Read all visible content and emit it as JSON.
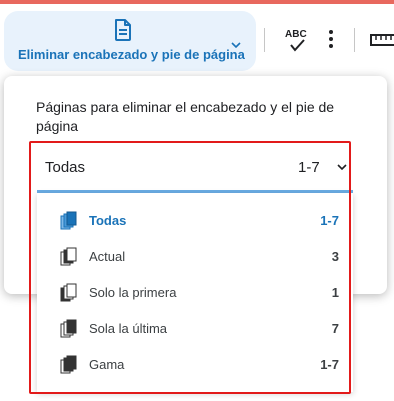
{
  "toolbar": {
    "main_button_label": "Eliminar encabezado y pie de página",
    "icons": [
      "document-icon",
      "chevron-down-icon",
      "spellcheck-abc-icon",
      "more-vert-icon",
      "ruler-icon"
    ]
  },
  "panel": {
    "title": "Páginas para eliminar el encabezado y el pie de página",
    "select": {
      "value": "Todas",
      "range": "1-7"
    },
    "options": [
      {
        "label": "Todas",
        "range": "1-7",
        "icon": "all-pages-icon",
        "selected": true
      },
      {
        "label": "Actual",
        "range": "3",
        "icon": "current-page-icon",
        "selected": false
      },
      {
        "label": "Solo la primera",
        "range": "1",
        "icon": "first-page-icon",
        "selected": false
      },
      {
        "label": "Sola la última",
        "range": "7",
        "icon": "last-page-icon",
        "selected": false
      },
      {
        "label": "Gama",
        "range": "1-7",
        "icon": "page-range-icon",
        "selected": false
      }
    ]
  },
  "colors": {
    "accent": "#1a73b8",
    "button_bg": "#e8f2fc",
    "highlight": "#e21a1a",
    "underline": "#6aace4"
  }
}
